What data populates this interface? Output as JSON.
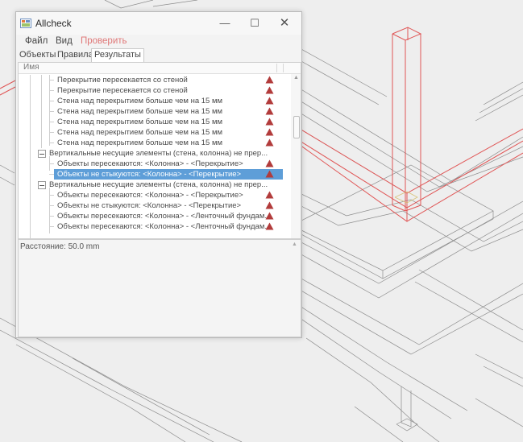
{
  "window": {
    "title": "Allcheck",
    "controls": {
      "minimize": "—",
      "maximize": "☐",
      "close": "✕"
    }
  },
  "menu": {
    "file": "Файл",
    "view": "Вид",
    "check": "Проверить",
    "check_color": "#e07878"
  },
  "tabs": {
    "objects": "Объекты",
    "rules": "Правила",
    "results": "Результаты",
    "active": "results"
  },
  "tree": {
    "column_name": "Имя",
    "rows": [
      {
        "label": "Перекрытие пересекается со стеной",
        "warning": true
      },
      {
        "label": "Перекрытие пересекается со стеной",
        "warning": true
      },
      {
        "label": "Стена над перекрытием больше чем на 15 мм",
        "warning": true
      },
      {
        "label": "Стена над перекрытием больше чем на 15 мм",
        "warning": true
      },
      {
        "label": "Стена над перекрытием больше чем на 15 мм",
        "warning": true
      },
      {
        "label": "Стена над перекрытием больше чем на 15 мм",
        "warning": true
      },
      {
        "label": "Стена над перекрытием больше чем на 15 мм",
        "warning": true
      },
      {
        "label": "Вертикальные несущие элементы (стена, колонна) не прер...",
        "warning": false,
        "group": true
      },
      {
        "label": "Объекты пересекаются: <Колонна> - <Перекрытие>",
        "warning": true
      },
      {
        "label": "Объекты не стыкуются: <Колонна> - <Перекрытие>",
        "warning": true,
        "selected": true
      },
      {
        "label": "Вертикальные несущие элементы (стена, колонна) не прер...",
        "warning": false,
        "group": true
      },
      {
        "label": "Объекты пересекаются: <Колонна> - <Перекрытие>",
        "warning": true
      },
      {
        "label": "Объекты не стыкуются: <Колонна> - <Перекрытие>",
        "warning": true
      },
      {
        "label": "Объекты пересекаются: <Колонна> - <Ленточный фундам...",
        "warning": true
      },
      {
        "label": "Объекты пересекаются: <Колонна> - <Ленточный фундам...",
        "warning": true
      }
    ]
  },
  "info": {
    "distance": "Расстояние: 50.0 mm"
  },
  "colors": {
    "warning": "#b23b3b",
    "selection": "#5e9ed8",
    "model_highlight": "#e05555",
    "model_lines": "#6a6a6a"
  },
  "icons": {
    "app": "app-icon",
    "warning": "warning-triangle-icon",
    "collapse": "collapse-minus-icon"
  }
}
